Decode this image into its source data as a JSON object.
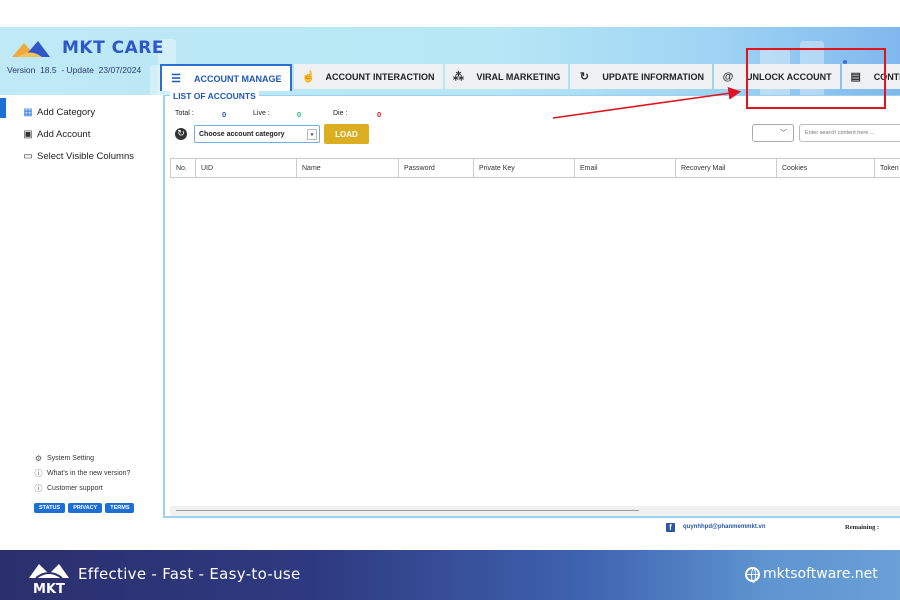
{
  "app": {
    "name": "MKT CARE",
    "version": "Version  18.5  - Update  23/07/2024"
  },
  "tabs": [
    {
      "label": "ACCOUNT MANAGE",
      "icon": "list-icon",
      "glyph": "☰",
      "active": true
    },
    {
      "label": "ACCOUNT INTERACTION",
      "icon": "hand-pointer-icon",
      "glyph": "☝",
      "active": false
    },
    {
      "label": "VIRAL MARKETING",
      "icon": "grid-nodes-icon",
      "glyph": "⁂",
      "active": false
    },
    {
      "label": "UPDATE INFORMATION",
      "icon": "refresh-check-icon",
      "glyph": "↻",
      "active": false
    },
    {
      "label": "UNLOCK ACCOUNT",
      "icon": "fingerprint-icon",
      "glyph": "@",
      "active": false
    },
    {
      "label": "CONTENT MANAGEMENT",
      "icon": "document-icon",
      "glyph": "▤",
      "active": false
    }
  ],
  "annotation": {
    "color": "#e0141e",
    "target": "CONTENT MANAGEMENT"
  },
  "sidebar": {
    "items": [
      {
        "label": "Add Category",
        "icon": "category-icon",
        "glyph": "▦"
      },
      {
        "label": "Add Account",
        "icon": "add-account-icon",
        "glyph": "▣"
      },
      {
        "label": "Select Visible Columns",
        "icon": "monitor-icon",
        "glyph": "▭"
      }
    ],
    "bottom": [
      {
        "label": "System Setting",
        "icon": "gear-icon",
        "glyph": "⚙"
      },
      {
        "label": "What's in the new version?",
        "icon": "info-icon",
        "glyph": "ⓘ"
      },
      {
        "label": "Customer support",
        "icon": "support-icon",
        "glyph": "ⓘ"
      }
    ],
    "pills": [
      "STATUS",
      "PRIVACY",
      "TERMS"
    ]
  },
  "panel": {
    "title": "LIST OF ACCOUNTS",
    "total_label": "Total :",
    "total_value": "0",
    "live_label": "Live :",
    "live_value": "0",
    "die_label": "Die :",
    "die_value": "0",
    "category_select": "Choose account category",
    "load_label": "LOAD",
    "filter_value": "",
    "search_placeholder": "Enter search content here ..."
  },
  "colors": {
    "total": "#1e57b8",
    "live": "#2bb673",
    "die": "#e0141e",
    "accent": "#1d6fd6",
    "load": "#dcae22"
  },
  "table": {
    "columns": [
      "No.",
      "UID",
      "Name",
      "Password",
      "Private Key",
      "Email",
      "Recovery Mail",
      "Cookies",
      "Token"
    ],
    "rows": []
  },
  "status": {
    "email": "quynhhpd@phanmemmkt.vn",
    "remaining_label": "Remaining :"
  },
  "banner": {
    "tagline": "Effective - Fast - Easy-to-use",
    "site": "mktsoftware.net"
  }
}
